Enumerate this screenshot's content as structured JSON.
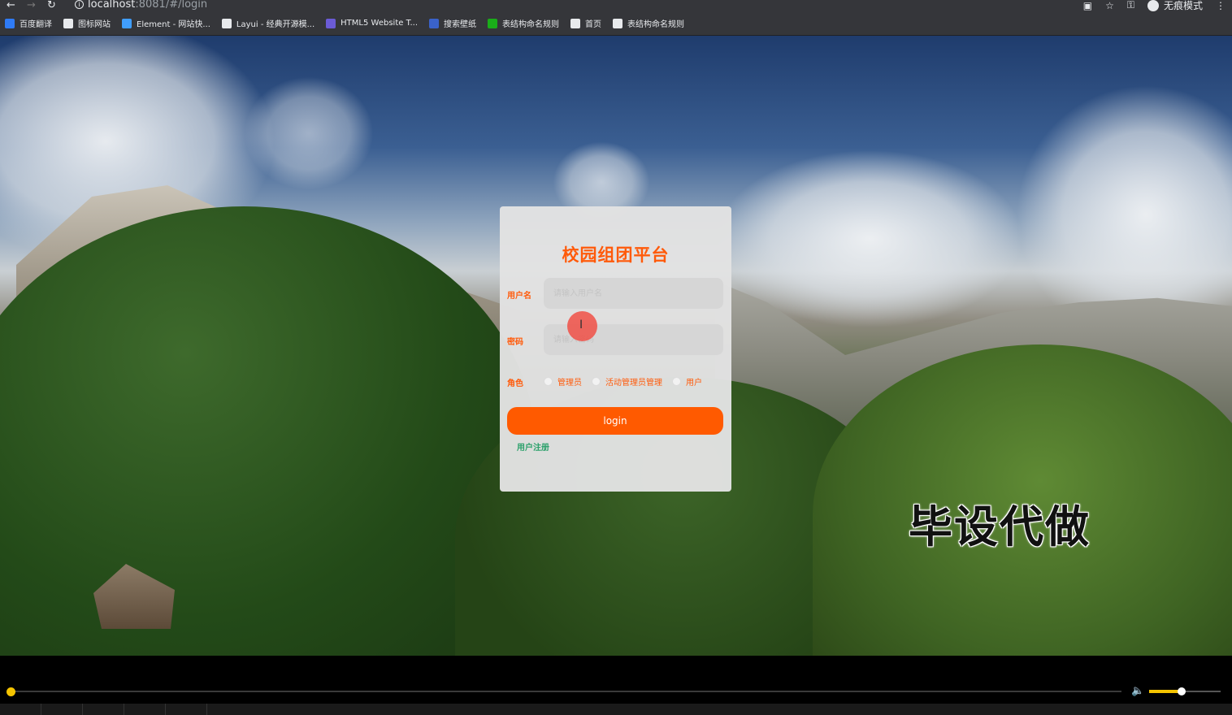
{
  "browser": {
    "url_host": "localhost",
    "url_rest": ":8081/#/login",
    "incognito_label": "无痕模式",
    "bookmarks": [
      {
        "label": "百度翻译",
        "color": "#2f7bf5"
      },
      {
        "label": "图标网站",
        "color": "#e8eaed"
      },
      {
        "label": "Element - 网站快...",
        "color": "#409eff"
      },
      {
        "label": "Layui - 经典开源模...",
        "color": "#e8eaed"
      },
      {
        "label": "HTML5 Website T...",
        "color": "#6b5bd6"
      },
      {
        "label": "搜索壁纸",
        "color": "#3a62c9"
      },
      {
        "label": "表结构命名规则",
        "color": "#1aad19"
      },
      {
        "label": "首页",
        "color": "#e8eaed"
      },
      {
        "label": "表结构命名规则",
        "color": "#e8eaed"
      }
    ]
  },
  "login": {
    "title": "校园组团平台",
    "username_label": "用户名",
    "username_placeholder": "请输入用户名",
    "password_label": "密码",
    "password_placeholder": "请输入密码",
    "role_label": "角色",
    "roles": [
      "管理员",
      "活动管理员管理",
      "用户"
    ],
    "login_button": "login",
    "register_link": "用户注册"
  },
  "watermark": "毕设代做",
  "player": {
    "progress": 0.0,
    "volume": 0.45,
    "accent_color": "#f5c400"
  },
  "colors": {
    "accent": "#ff5a0a",
    "link": "#2aa06a"
  }
}
